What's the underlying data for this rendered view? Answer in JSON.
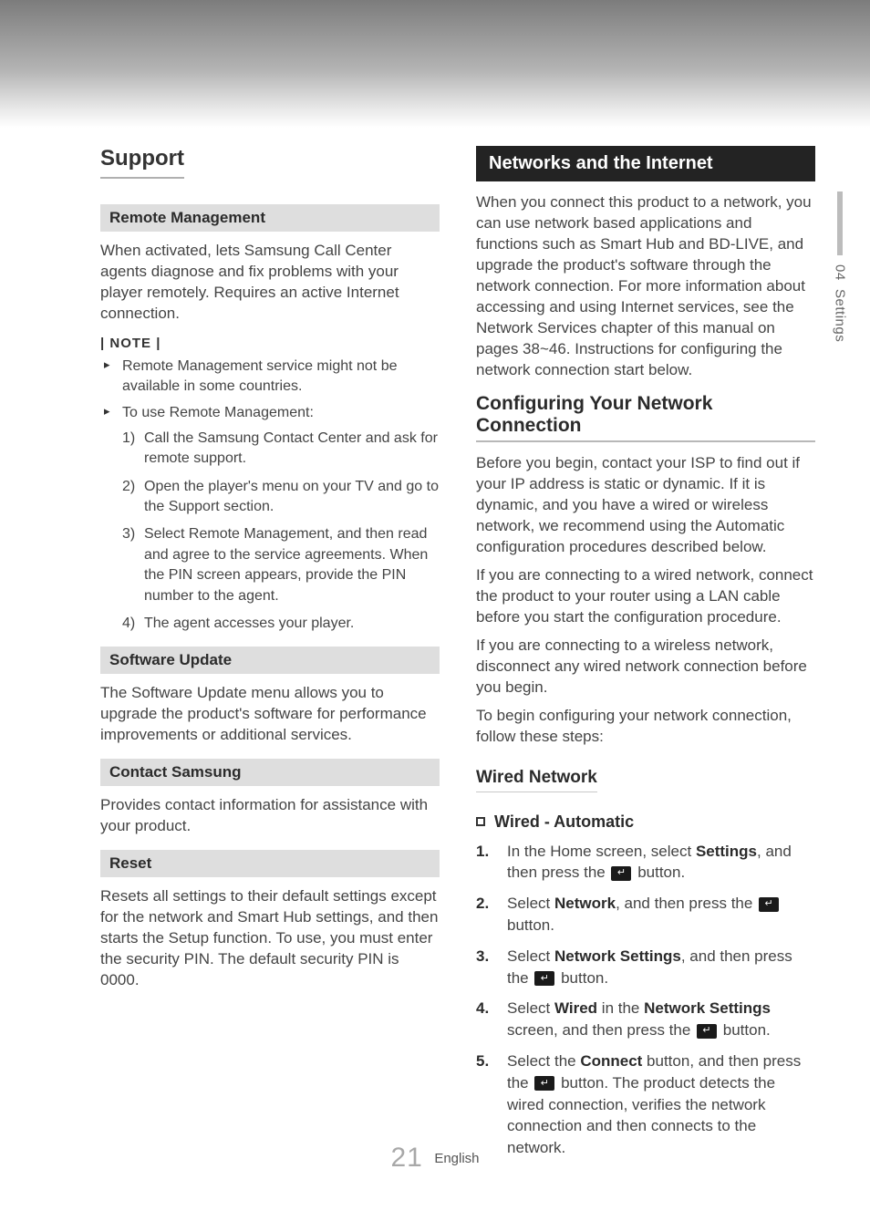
{
  "side_tab": {
    "chapter": "04",
    "title": "Settings"
  },
  "left": {
    "support_title": "Support",
    "remote_mgmt": {
      "heading": "Remote Management",
      "body": "When activated, lets Samsung Call Center agents diagnose and fix problems with your player remotely. Requires an active Internet connection.",
      "note_label": "| NOTE |",
      "notes": [
        "Remote Management service might not be available in some countries.",
        "To use Remote Management:"
      ],
      "steps": [
        "Call the Samsung Contact Center and ask for remote support.",
        "Open the player's menu on your TV and go to the Support section.",
        "Select Remote Management, and then read and agree to the service agreements. When the PIN screen appears, provide the PIN number to the agent.",
        "The agent accesses your player."
      ]
    },
    "software_update": {
      "heading": "Software Update",
      "body": "The Software Update menu allows you to upgrade the product's software for performance improvements or additional services."
    },
    "contact": {
      "heading": "Contact Samsung",
      "body": "Provides contact information for assistance with your product."
    },
    "reset": {
      "heading": "Reset",
      "body": "Resets all settings to their default settings except for the network and Smart Hub settings, and then starts the Setup function. To use, you must enter the security PIN. The default security PIN is 0000."
    }
  },
  "right": {
    "net_heading": "Networks and the Internet",
    "net_intro": "When you connect this product to a network, you can use network based applications and functions such as Smart Hub and BD-LIVE, and upgrade the product's software through the network connection. For more information about accessing and using Internet services, see the Network Services chapter of this manual on pages 38~46. Instructions for configuring the network connection start below.",
    "config_title": "Configuring Your Network Connection",
    "config_p1": "Before you begin, contact your ISP to find out if your IP address is static or dynamic. If it is dynamic, and you have a wired or wireless network, we recommend using the Automatic configuration procedures described below.",
    "config_p2": "If you are connecting to a wired network, connect the product to your router using a LAN cable before you start the configuration procedure.",
    "config_p3": "If you are connecting to a wireless network, disconnect any wired network connection before you begin.",
    "config_p4": "To begin configuring your network connection, follow these steps:",
    "wired_title": "Wired Network",
    "wired_auto_label": "Wired - Automatic",
    "steps": {
      "s1a": "In the Home screen, select ",
      "s1b": "Settings",
      "s1c": ", and then press the ",
      "s1d": " button.",
      "s2a": "Select ",
      "s2b": "Network",
      "s2c": ", and then press the ",
      "s2d": " button.",
      "s3a": "Select ",
      "s3b": "Network Settings",
      "s3c": ", and then press the ",
      "s3d": " button.",
      "s4a": "Select ",
      "s4b": "Wired",
      "s4c": " in the ",
      "s4d": "Network Settings",
      "s4e": " screen, and then press the ",
      "s4f": " button.",
      "s5a": "Select the ",
      "s5b": "Connect",
      "s5c": " button, and then press the ",
      "s5d": " button. The product detects the wired connection, verifies the network connection and then connects to the network."
    }
  },
  "footer": {
    "page": "21",
    "lang": "English"
  }
}
